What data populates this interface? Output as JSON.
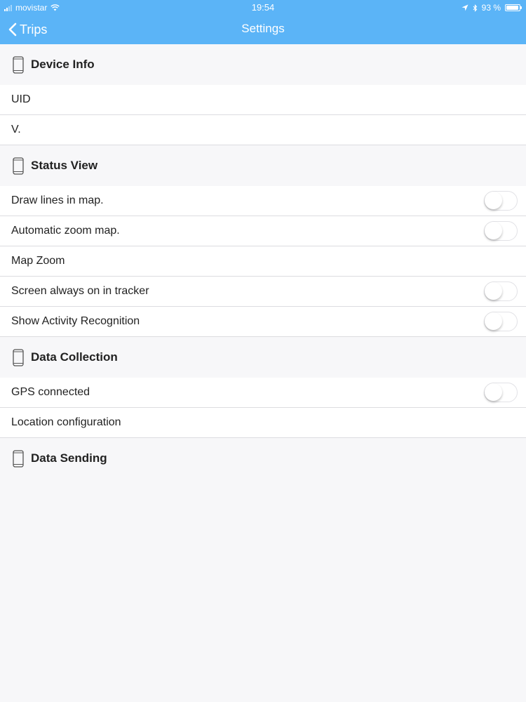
{
  "status_bar": {
    "carrier": "movistar",
    "time": "19:54",
    "battery_text": "93 %",
    "battery_level": 0.93
  },
  "nav": {
    "back_label": "Trips",
    "title": "Settings"
  },
  "sections": {
    "device_info": {
      "title": "Device Info",
      "rows": [
        "UID",
        "V."
      ]
    },
    "status_view": {
      "title": "Status View",
      "rows": [
        "Draw lines in map.",
        "Automatic zoom map.",
        "Map Zoom",
        "Screen always on in tracker",
        "Show Activity Recognition"
      ]
    },
    "data_collection": {
      "title": "Data Collection",
      "rows": [
        "GPS connected",
        "Location configuration"
      ]
    },
    "data_sending": {
      "title": "Data Sending"
    }
  },
  "icons": {
    "section_icon": "phone-icon",
    "back_icon": "chevron-left-icon"
  },
  "colors": {
    "nav_background": "#5bb4f7",
    "page_background": "#f7f7f9"
  }
}
